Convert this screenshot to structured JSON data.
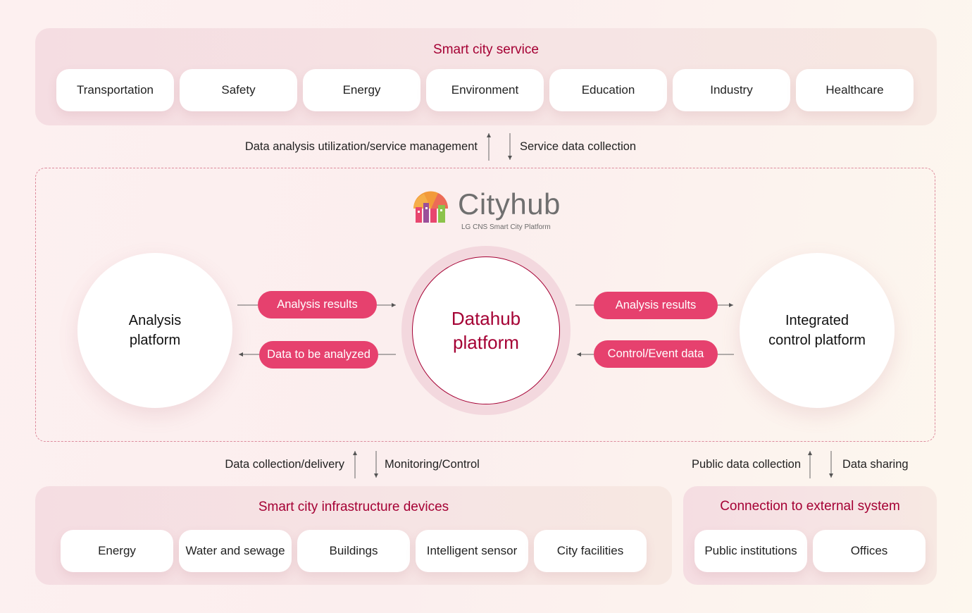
{
  "service": {
    "title": "Smart city service",
    "items": [
      "Transportation",
      "Safety",
      "Energy",
      "Environment",
      "Education",
      "Industry",
      "Healthcare"
    ]
  },
  "top_flows": {
    "up": "Data analysis utilization/service management",
    "down": "Service data collection"
  },
  "cityhub": {
    "name": "Cityhub",
    "tagline": "LG CNS Smart City Platform",
    "colors": {
      "orange": "#f29a3a",
      "pink": "#e8466f",
      "green": "#8bc34a",
      "purple": "#9b4f9a"
    }
  },
  "core": {
    "left": "Analysis\nplatform",
    "center": "Datahub\nplatform",
    "right": "Integrated\ncontrol platform",
    "left_pills": [
      "Analysis results",
      "Data to be analyzed"
    ],
    "right_pills": [
      "Analysis results",
      "Control/Event data"
    ]
  },
  "bottom_flows": {
    "left_up": "Data collection/delivery",
    "left_down": "Monitoring/Control",
    "right_up": "Public data collection",
    "right_down": "Data sharing"
  },
  "infra": {
    "title": "Smart city infrastructure devices",
    "items": [
      "Energy",
      "Water and sewage",
      "Buildings",
      "Intelligent sensor",
      "City facilities"
    ]
  },
  "external": {
    "title": "Connection to external system",
    "items": [
      "Public institutions",
      "Offices"
    ]
  },
  "colors": {
    "accent": "#a50034",
    "pill": "#e6416e",
    "panel": "#f5dde2"
  }
}
